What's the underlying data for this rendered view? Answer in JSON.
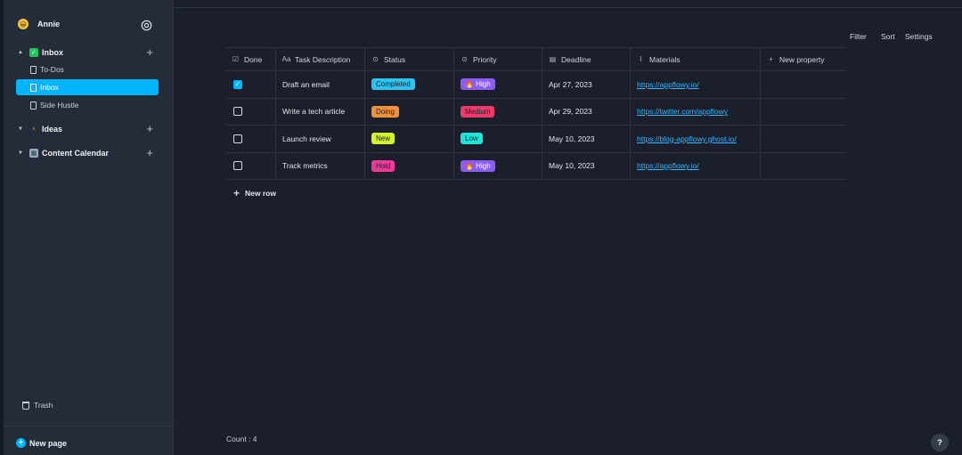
{
  "sidebar": {
    "user": {
      "name": "Annie",
      "emoji": "😀"
    },
    "settings_icon": "gear-icon",
    "sections": [
      {
        "label": "Inbox",
        "emoji": "✓",
        "emoji_color": "#22c55e",
        "add": "+"
      },
      {
        "label": "Ideas",
        "emoji": "⚡",
        "emoji_color": "#f59e0b",
        "add": "+"
      },
      {
        "label": "Content Calendar",
        "emoji": "▦",
        "emoji_color": "#9aa8c2",
        "add": "+"
      }
    ],
    "pages": [
      {
        "label": "To-Dos"
      },
      {
        "label": "Inbox"
      },
      {
        "label": "Side Hustle"
      }
    ],
    "trash": "Trash",
    "new_page": "New page"
  },
  "toolbar": {
    "filter": "Filter",
    "sort": "Sort",
    "settings": "Settings"
  },
  "table": {
    "columns": [
      {
        "label": "Done",
        "icon": "checkbox-icon"
      },
      {
        "label": "Task Description",
        "icon": "text-icon"
      },
      {
        "label": "Status",
        "icon": "select-icon"
      },
      {
        "label": "Priority",
        "icon": "select-icon"
      },
      {
        "label": "Deadline",
        "icon": "calendar-icon"
      },
      {
        "label": "Materials",
        "icon": "paperclip-icon"
      },
      {
        "label": "New property",
        "icon": "plus-icon"
      }
    ],
    "rows": [
      {
        "done": true,
        "task": "Draft an email",
        "status": "Completed",
        "status_color": "#2bc3f0",
        "priority": "🔥 High",
        "priority_color": "#8b5cf6",
        "deadline": "Apr 27, 2023",
        "materials": "https://appflowy.io/"
      },
      {
        "done": false,
        "task": "Write a tech article",
        "status": "Doing",
        "status_color": "#f0913a",
        "priority": "Medium",
        "priority_color": "#f0386b",
        "deadline": "Apr 29, 2023",
        "materials": "https://twitter.com/appflowy"
      },
      {
        "done": false,
        "task": "Launch review",
        "status": "New",
        "status_color": "#d4f12b",
        "priority": "Low",
        "priority_color": "#1fe5d9",
        "deadline": "May 10, 2023",
        "materials": "https://blog-appflowy.ghost.io/"
      },
      {
        "done": false,
        "task": "Track metrics",
        "status": "Hold",
        "status_color": "#f0389b",
        "priority": "🔥 High",
        "priority_color": "#8b5cf6",
        "deadline": "May 10, 2023",
        "materials": "https://appflowy.io/"
      }
    ],
    "new_row": "New row",
    "count": "Count : 4"
  },
  "help": "?"
}
